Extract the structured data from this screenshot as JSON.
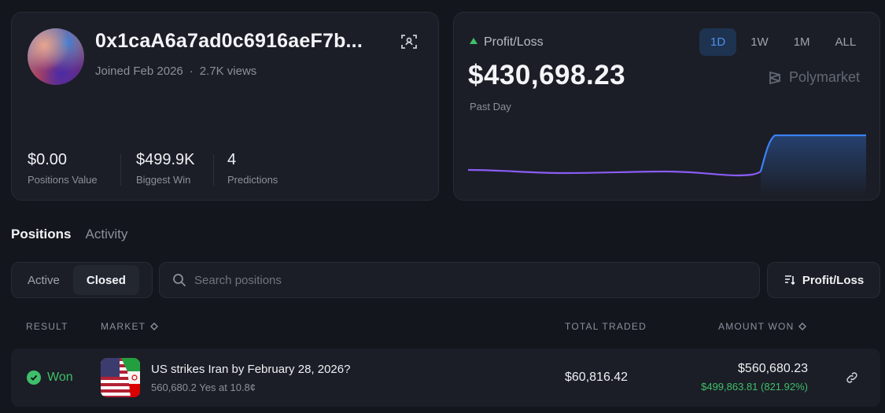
{
  "profile": {
    "wallet": "0x1caA6a7ad0c6916aeF7b...",
    "joined": "Joined Feb 2026",
    "views": "2.7K views",
    "stats": [
      {
        "value": "$0.00",
        "label": "Positions Value"
      },
      {
        "value": "$499.9K",
        "label": "Biggest Win"
      },
      {
        "value": "4",
        "label": "Predictions"
      }
    ]
  },
  "pnl": {
    "heading": "Profit/Loss",
    "amount": "$430,698.23",
    "period_label": "Past Day",
    "ranges": [
      "1D",
      "1W",
      "1M",
      "ALL"
    ],
    "active_range": "1D",
    "brand": "Polymarket",
    "colors": {
      "line_before": "#8b5cf6",
      "line_after": "#3b82f6",
      "up": "#3fbf6a"
    }
  },
  "tabs": [
    "Positions",
    "Activity"
  ],
  "filters": {
    "segments": [
      "Active",
      "Closed"
    ],
    "active_segment": "Closed",
    "search_placeholder": "Search positions",
    "sort_label": "Profit/Loss"
  },
  "table": {
    "headers": {
      "result": "RESULT",
      "market": "MARKET",
      "total_traded": "TOTAL TRADED",
      "amount_won": "AMOUNT WON"
    },
    "rows": [
      {
        "result": "Won",
        "market_title": "US strikes Iran by February 28, 2026?",
        "market_sub": "560,680.2 Yes at 10.8¢",
        "total_traded": "$60,816.42",
        "amount_won": "$560,680.23",
        "profit": "$499,863.81 (821.92%)"
      }
    ]
  }
}
